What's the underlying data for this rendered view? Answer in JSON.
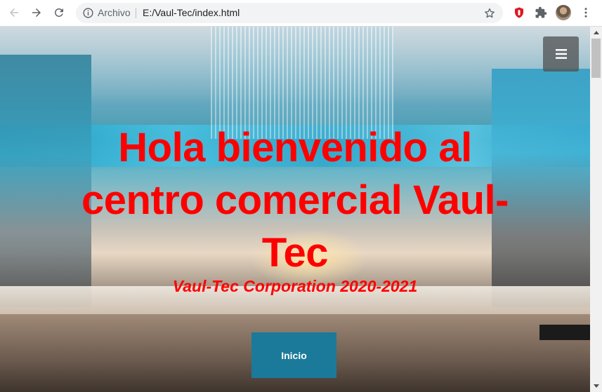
{
  "browser": {
    "address_label": "Archivo",
    "address_url": "E:/Vaul-Tec/index.html",
    "icons": [
      "back-icon",
      "forward-icon",
      "reload-icon",
      "info-icon",
      "star-icon",
      "extension-red-icon",
      "puzzle-icon",
      "avatar",
      "kebab-menu-icon"
    ]
  },
  "page": {
    "title": "Hola bienvenido al centro comercial Vaul-Tec",
    "subtitle": "Vaul-Tec Corporation 2020-2021",
    "button_label": "Inicio",
    "menu_icon": "hamburger-icon"
  },
  "colors": {
    "title": "#ff0000",
    "button_bg": "#1b7a99",
    "menu_bg": "#505050"
  }
}
